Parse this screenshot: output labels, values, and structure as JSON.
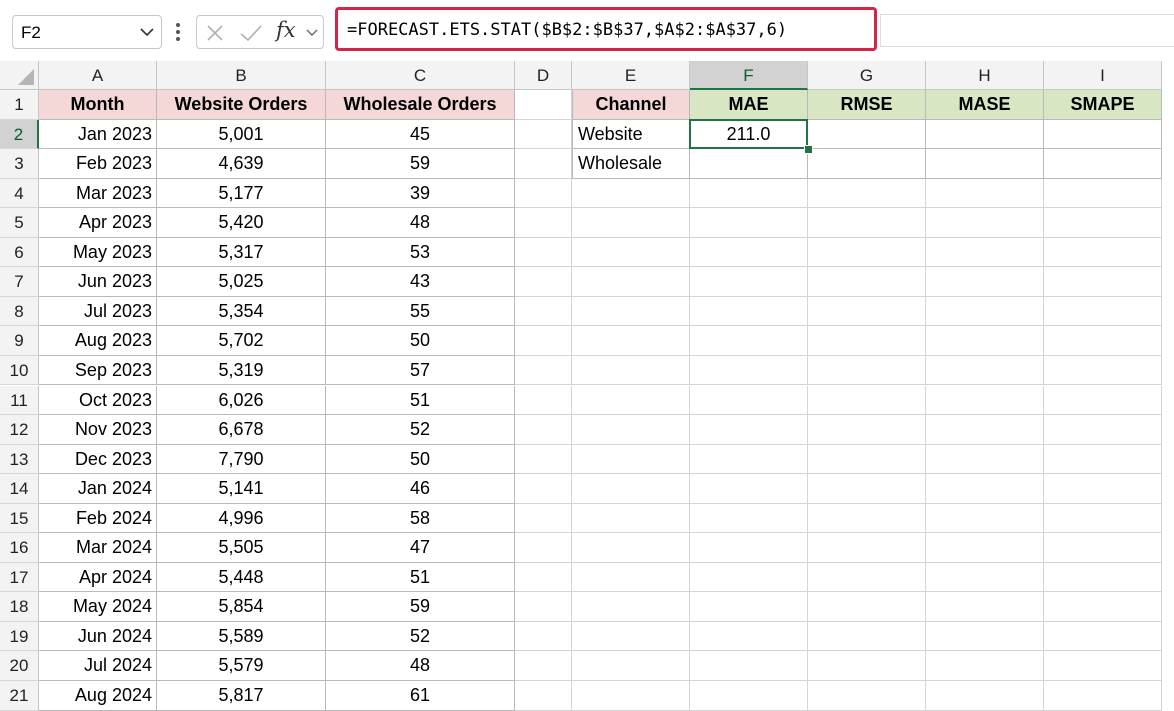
{
  "name_box": {
    "value": "F2"
  },
  "formula_bar": {
    "formula": "=FORECAST.ETS.STAT($B$2:$B$37,$A$2:$A$37,6)",
    "fx_label": "fx"
  },
  "columns": [
    "A",
    "B",
    "C",
    "D",
    "E",
    "F",
    "G",
    "H",
    "I"
  ],
  "selected_column": "F",
  "rows": [
    "1",
    "2",
    "3",
    "4",
    "5",
    "6",
    "7",
    "8",
    "9",
    "10",
    "11",
    "12",
    "13",
    "14",
    "15",
    "16",
    "17",
    "18",
    "19",
    "20",
    "21"
  ],
  "selected_row": "2",
  "table_left": {
    "headers": [
      "Month",
      "Website Orders",
      "Wholesale Orders"
    ],
    "rows": [
      [
        "Jan 2023",
        "5,001",
        "45"
      ],
      [
        "Feb 2023",
        "4,639",
        "59"
      ],
      [
        "Mar 2023",
        "5,177",
        "39"
      ],
      [
        "Apr 2023",
        "5,420",
        "48"
      ],
      [
        "May 2023",
        "5,317",
        "53"
      ],
      [
        "Jun 2023",
        "5,025",
        "43"
      ],
      [
        "Jul 2023",
        "5,354",
        "55"
      ],
      [
        "Aug 2023",
        "5,702",
        "50"
      ],
      [
        "Sep 2023",
        "5,319",
        "57"
      ],
      [
        "Oct 2023",
        "6,026",
        "51"
      ],
      [
        "Nov 2023",
        "6,678",
        "52"
      ],
      [
        "Dec 2023",
        "7,790",
        "50"
      ],
      [
        "Jan 2024",
        "5,141",
        "46"
      ],
      [
        "Feb 2024",
        "4,996",
        "58"
      ],
      [
        "Mar 2024",
        "5,505",
        "47"
      ],
      [
        "Apr 2024",
        "5,448",
        "51"
      ],
      [
        "May 2024",
        "5,854",
        "59"
      ],
      [
        "Jun 2024",
        "5,589",
        "52"
      ],
      [
        "Jul 2024",
        "5,579",
        "48"
      ],
      [
        "Aug 2024",
        "5,817",
        "61"
      ]
    ]
  },
  "table_right": {
    "headers": [
      "Channel",
      "MAE",
      "RMSE",
      "MASE",
      "SMAPE"
    ],
    "rows": [
      [
        "Website",
        "211.0",
        "",
        "",
        ""
      ],
      [
        "Wholesale",
        "",
        "",
        "",
        ""
      ]
    ]
  },
  "colors": {
    "accent_green": "#217346",
    "formula_highlight": "#d6234a",
    "header_pink": "#f4d7d7",
    "header_green": "#d9e6c3"
  }
}
